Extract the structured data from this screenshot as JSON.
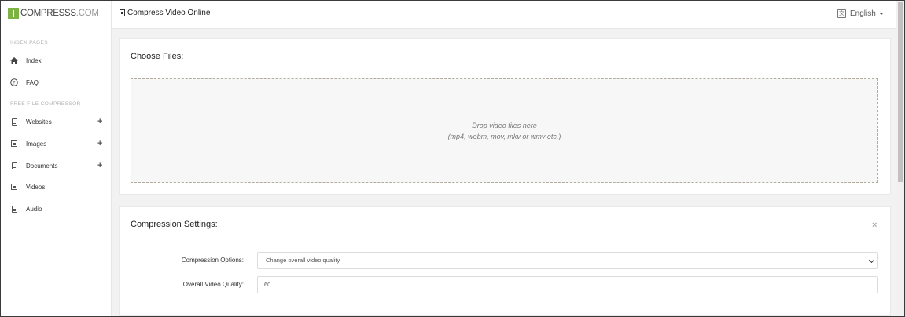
{
  "brand": {
    "name": "COMPRESSS",
    "tld": ".COM"
  },
  "sidebar": {
    "section_index": "INDEX PAGES",
    "section_free": "FREE FILE COMPRESSOR",
    "items": [
      {
        "label": "Index",
        "icon": "home-icon"
      },
      {
        "label": "FAQ",
        "icon": "question-circle-icon"
      },
      {
        "label": "Websites",
        "icon": "html-file-icon",
        "expand": "+"
      },
      {
        "label": "Images",
        "icon": "image-file-icon",
        "expand": "+"
      },
      {
        "label": "Documents",
        "icon": "document-icon",
        "expand": "+"
      },
      {
        "label": "Videos",
        "icon": "video-file-icon"
      },
      {
        "label": "Audio",
        "icon": "audio-file-icon"
      }
    ]
  },
  "header": {
    "title": "Compress Video Online",
    "language": "English"
  },
  "choose_files": {
    "title": "Choose Files:",
    "drop_line1": "Drop video files here",
    "drop_line2": "(mp4, webm, mov, mkv or wmv etc.)"
  },
  "settings": {
    "title": "Compression Settings:",
    "close": "×",
    "options_label": "Compression Options:",
    "options_value": "Change overall video quality",
    "quality_label": "Overall Video Quality:",
    "quality_value": "60"
  }
}
